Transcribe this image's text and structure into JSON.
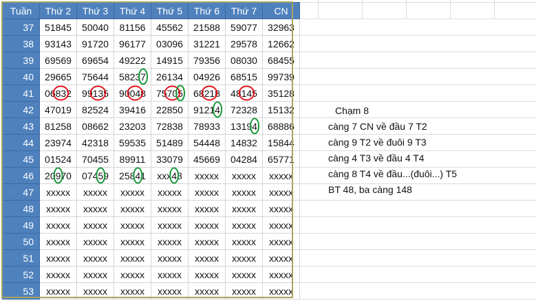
{
  "table": {
    "header": [
      "Tuần",
      "Thứ 2",
      "Thứ 3",
      "Thứ 4",
      "Thứ 5",
      "Thứ 6",
      "Thứ 7",
      "CN"
    ],
    "rows": [
      [
        "37",
        "51845",
        "50040",
        "81156",
        "45562",
        "21588",
        "59077",
        "32963"
      ],
      [
        "38",
        "93143",
        "91720",
        "96177",
        "03096",
        "31221",
        "29578",
        "12662"
      ],
      [
        "39",
        "69569",
        "69654",
        "49222",
        "14915",
        "79356",
        "08030",
        "68455"
      ],
      [
        "40",
        "29665",
        "75644",
        "58237",
        "26134",
        "04926",
        "68515",
        "99739"
      ],
      [
        "41",
        "06832",
        "99135",
        "90048",
        "75705",
        "68218",
        "48145",
        "35128"
      ],
      [
        "42",
        "47019",
        "82524",
        "39416",
        "22850",
        "91214",
        "72328",
        "15132"
      ],
      [
        "43",
        "81258",
        "08662",
        "23203",
        "72838",
        "78933",
        "13194",
        "68886"
      ],
      [
        "44",
        "23974",
        "42318",
        "59535",
        "51489",
        "54448",
        "14832",
        "15844"
      ],
      [
        "45",
        "01524",
        "70455",
        "89911",
        "33079",
        "45669",
        "04284",
        "65771"
      ],
      [
        "46",
        "20970",
        "07459",
        "25841",
        "xxx48",
        "xxxxx",
        "xxxxx",
        "xxxxx"
      ],
      [
        "47",
        "xxxxx",
        "xxxxx",
        "xxxxx",
        "xxxxx",
        "xxxxx",
        "xxxxx",
        "xxxxx"
      ],
      [
        "48",
        "xxxxx",
        "xxxxx",
        "xxxxx",
        "xxxxx",
        "xxxxx",
        "xxxxx",
        "xxxxx"
      ],
      [
        "49",
        "xxxxx",
        "xxxxx",
        "xxxxx",
        "xxxxx",
        "xxxxx",
        "xxxxx",
        "xxxxx"
      ],
      [
        "50",
        "xxxxx",
        "xxxxx",
        "xxxxx",
        "xxxxx",
        "xxxxx",
        "xxxxx",
        "xxxxx"
      ],
      [
        "51",
        "xxxxx",
        "xxxxx",
        "xxxxx",
        "xxxxx",
        "xxxxx",
        "xxxxx",
        "xxxxx"
      ],
      [
        "52",
        "xxxxx",
        "xxxxx",
        "xxxxx",
        "xxxxx",
        "xxxxx",
        "xxxxx",
        "xxxxx"
      ],
      [
        "53",
        "xxxxx",
        "xxxxx",
        "xxxxx",
        "xxxxx",
        "xxxxx",
        "xxxxx",
        "xxxxx"
      ]
    ]
  },
  "notes": [
    "Chạm 8",
    "càng 7 CN về đầu 7 T2",
    "càng 9 T2 về đuôi 9 T3",
    "càng 4 T3 về đầu 4 T4",
    "càng 8 T4 về đầu...(đuôi...) T5",
    "BT 48, ba càng 148"
  ],
  "colors": {
    "header_fill": "#4f81bd",
    "header_text": "#ffffff",
    "frame": "#a9a45f",
    "red_mark": "#e8141b",
    "green_mark": "#1a9a3c"
  },
  "annotations": {
    "red_circles": [
      {
        "week": "41",
        "day": "Thứ 2",
        "digits": "83"
      },
      {
        "week": "41",
        "day": "Thứ 3",
        "digits": "13"
      },
      {
        "week": "41",
        "day": "Thứ 4",
        "digits": "04"
      },
      {
        "week": "41",
        "day": "Thứ 5",
        "digits": "70"
      },
      {
        "week": "41",
        "day": "Thứ 6",
        "digits": "21"
      },
      {
        "week": "41",
        "day": "Thứ 7",
        "digits": "14"
      }
    ],
    "green_ovals": [
      {
        "week": "40",
        "day": "Thứ 4",
        "digit": "7"
      },
      {
        "week": "41",
        "day": "Thứ 5",
        "digit": "5"
      },
      {
        "week": "42",
        "day": "Thứ 6",
        "digit": "4"
      },
      {
        "week": "43",
        "day": "Thứ 7",
        "digit": "4"
      },
      {
        "week": "46",
        "day": "Thứ 2",
        "digit": "9"
      },
      {
        "week": "46",
        "day": "Thứ 3",
        "digit": "5"
      },
      {
        "week": "46",
        "day": "Thứ 4",
        "digit": "4"
      },
      {
        "week": "46",
        "day": "Thứ 5",
        "digit": "4"
      }
    ]
  }
}
